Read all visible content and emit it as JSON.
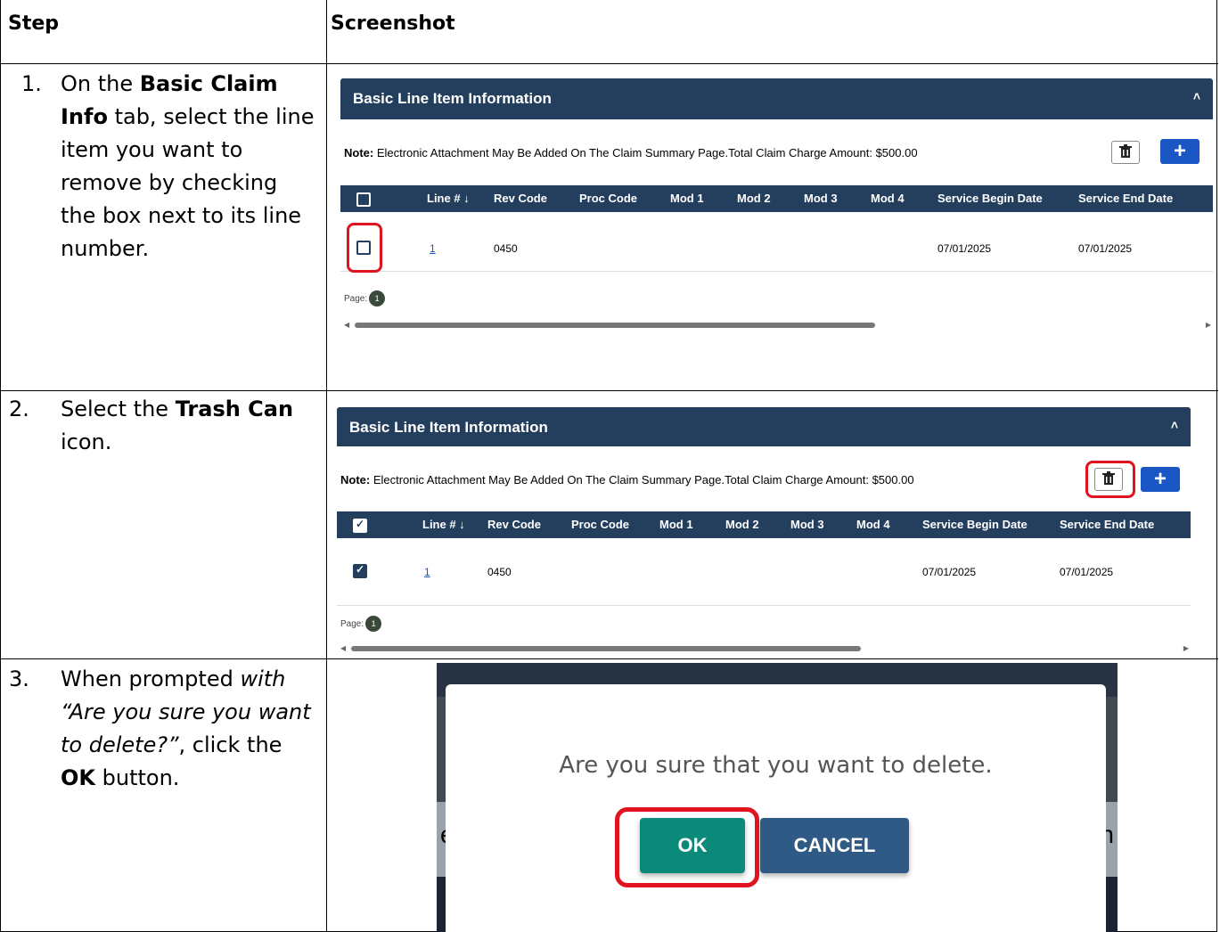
{
  "header": {
    "step_label": "Step",
    "screenshot_label": "Screenshot"
  },
  "steps": [
    {
      "num": "1.",
      "parts": [
        "On the ",
        "Basic Claim Info",
        " tab, select the line item you want to remove by checking the box next to its line number."
      ]
    },
    {
      "num": "2.",
      "parts": [
        "Select the ",
        "Trash Can",
        " icon."
      ]
    },
    {
      "num": "3.",
      "parts": [
        "When prompted ",
        "with “Are you sure you want to delete?”",
        ", click the ",
        "OK",
        " button."
      ]
    }
  ],
  "panel": {
    "title": "Basic Line Item Information",
    "note_bold": "Note:",
    "note_text": " Electronic Attachment May Be Added On The Claim Summary Page.Total Claim Charge Amount: $500.00",
    "columns": [
      "Line # ↓",
      "Rev Code",
      "Proc Code",
      "Mod 1",
      "Mod 2",
      "Mod 3",
      "Mod 4",
      "Service Begin Date",
      "Service End Date"
    ],
    "row": {
      "line": "1",
      "rev_code": "0450",
      "begin": "07/01/2025",
      "end": "07/01/2025"
    },
    "page_label": "Page:",
    "page_num": "1"
  },
  "dialog": {
    "message": "Are you sure that you want to delete.",
    "ok_label": "OK",
    "cancel_label": "CANCEL",
    "ghost_left": "e",
    "ghost_right": "n"
  },
  "icons": [
    "trash-icon",
    "plus-icon",
    "caret-up-icon",
    "checkbox-icon"
  ]
}
